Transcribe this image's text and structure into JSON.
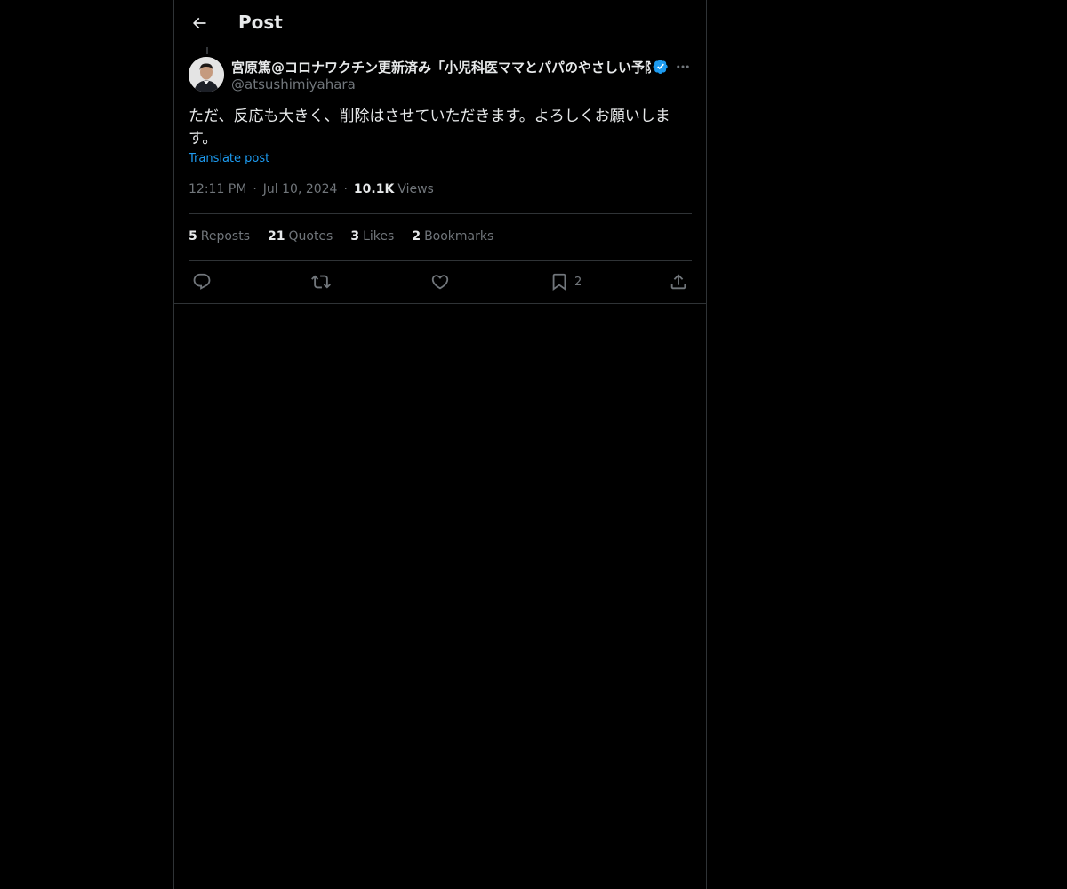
{
  "header": {
    "title": "Post"
  },
  "author": {
    "display_name": "宮原篤@コロナワクチン更新済み「小児科医ママとパパのやさしい予防接種BOOK」発売中",
    "handle": "@atsushimiyahara",
    "verified": true
  },
  "post": {
    "text_line1": "ただ、反応も大きく、削除はさせていただきます。よろしくお願いしま",
    "text_line2": "す。",
    "translate_label": "Translate post",
    "time": "12:11 PM",
    "date": "Jul 10, 2024",
    "views_count": "10.1K",
    "views_label": "Views",
    "separator": "·"
  },
  "stats": [
    {
      "count": "5",
      "label": "Reposts"
    },
    {
      "count": "21",
      "label": "Quotes"
    },
    {
      "count": "3",
      "label": "Likes"
    },
    {
      "count": "2",
      "label": "Bookmarks"
    }
  ],
  "actions": {
    "reply_icon": "reply-icon",
    "repost_icon": "repost-icon",
    "like_icon": "like-icon",
    "bookmark_icon": "bookmark-icon",
    "bookmark_count": "2",
    "share_icon": "share-icon"
  },
  "colors": {
    "background": "#000000",
    "text": "#e7e9ea",
    "secondary": "#71767b",
    "accent": "#1d9bf0",
    "border": "#2f3336"
  }
}
